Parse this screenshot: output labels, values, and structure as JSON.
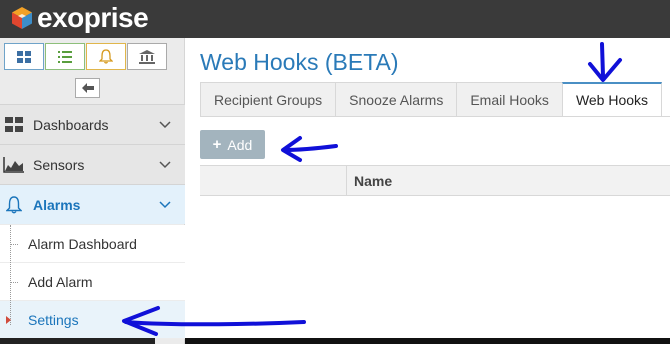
{
  "brand": {
    "name": "exoprise"
  },
  "sidebar": {
    "quick_icons": [
      "dashboard-grid-icon",
      "list-icon",
      "bell-icon",
      "bank-icon"
    ],
    "nav": [
      {
        "label": "Dashboards",
        "icon": "dashboard-grid-icon"
      },
      {
        "label": "Sensors",
        "icon": "sensor-chart-icon"
      },
      {
        "label": "Alarms",
        "icon": "bell-icon",
        "active": true
      }
    ],
    "alarm_subitems": [
      {
        "label": "Alarm Dashboard"
      },
      {
        "label": "Add Alarm"
      },
      {
        "label": "Settings",
        "current": true
      }
    ]
  },
  "main": {
    "title": "Web Hooks (BETA)",
    "tabs": [
      {
        "label": "Recipient Groups"
      },
      {
        "label": "Snooze Alarms"
      },
      {
        "label": "Email Hooks"
      },
      {
        "label": "Web Hooks",
        "active": true
      }
    ],
    "add_label": "Add",
    "table": {
      "columns": [
        "",
        "Name"
      ]
    }
  },
  "colors": {
    "topbar": "#3a3a3a",
    "title_blue": "#2a7ab8",
    "active_nav": "#1b75bb",
    "annotation_blue": "#1010d8"
  }
}
